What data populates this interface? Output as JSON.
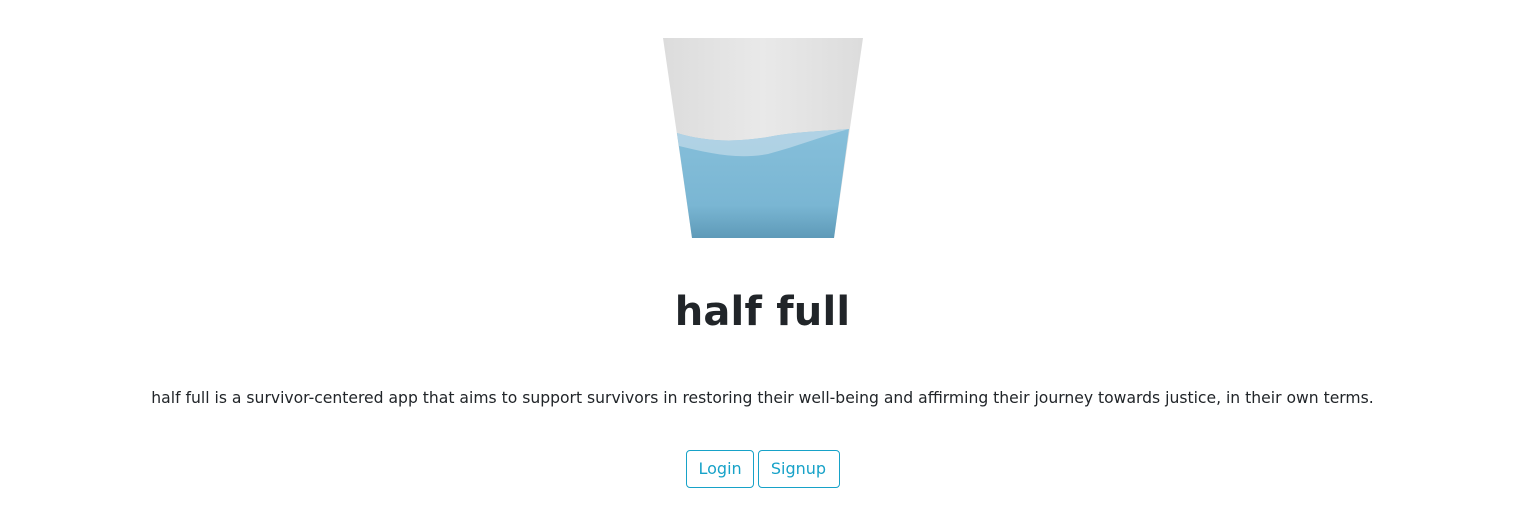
{
  "app": {
    "title": "half full",
    "tagline": "half full is a survivor-centered app that aims to support survivors in restoring their well-being and affirming their journey towards justice, in their own terms."
  },
  "logo": {
    "icon": "half-full-glass-icon",
    "fill_level": 0.5,
    "colors": {
      "glass": "#e8e8e8",
      "water": "#7fbad6",
      "water_dark": "#5a9ab8",
      "wave_highlight": "#b5d5e5"
    }
  },
  "actions": {
    "login_label": "Login",
    "signup_label": "Signup",
    "accent_color": "#17a2c8"
  }
}
